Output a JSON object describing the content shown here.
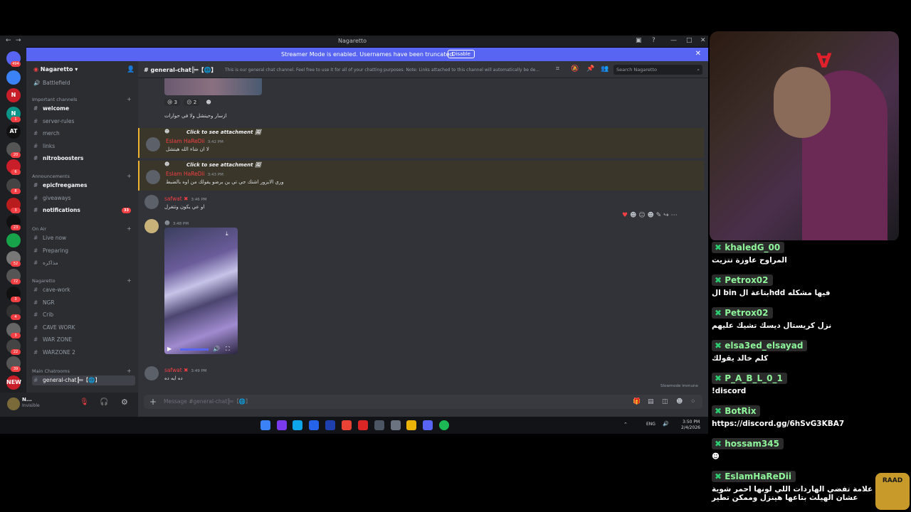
{
  "window": {
    "title": "Nagaretto"
  },
  "banner": {
    "message": "Streamer Mode is enabled. Usernames have been truncated.",
    "button": "Disable"
  },
  "rail": {
    "servers": [
      {
        "label": "",
        "badge": "494"
      },
      {
        "label": "",
        "badge": ""
      },
      {
        "label": "N",
        "badge": ""
      },
      {
        "label": "N",
        "badge": "1"
      },
      {
        "label": "AT",
        "badge": ""
      },
      {
        "label": "",
        "badge": "20"
      },
      {
        "label": "",
        "badge": "6"
      },
      {
        "label": "",
        "badge": "8"
      },
      {
        "label": "",
        "badge": "3"
      },
      {
        "label": "",
        "badge": "23"
      },
      {
        "label": "",
        "badge": ""
      },
      {
        "label": "",
        "badge": "52"
      },
      {
        "label": "",
        "badge": "72"
      },
      {
        "label": "",
        "badge": "3"
      },
      {
        "label": "",
        "badge": "4"
      },
      {
        "label": "",
        "badge": "3"
      },
      {
        "label": "",
        "badge": "22"
      },
      {
        "label": "",
        "badge": "39"
      },
      {
        "label": "NEW",
        "badge": ""
      }
    ]
  },
  "sidebar": {
    "server_name": "Nagaretto",
    "top_channel": "Battlefield",
    "categories": [
      {
        "name": "Important channels",
        "channels": [
          {
            "name": "welcome",
            "unread": true,
            "count": ""
          },
          {
            "name": "server-rules",
            "unread": false,
            "count": ""
          },
          {
            "name": "merch",
            "unread": false,
            "count": ""
          },
          {
            "name": "links",
            "unread": false,
            "count": ""
          },
          {
            "name": "nitroboosters",
            "unread": true,
            "count": ""
          }
        ]
      },
      {
        "name": "Announcements",
        "channels": [
          {
            "name": "epicfreegames",
            "unread": true,
            "count": ""
          },
          {
            "name": "giveaways",
            "unread": false,
            "count": ""
          },
          {
            "name": "notifications",
            "unread": true,
            "count": "33"
          }
        ]
      },
      {
        "name": "On Air",
        "channels": [
          {
            "name": "Live now",
            "unread": false,
            "count": ""
          },
          {
            "name": "Preparing",
            "unread": false,
            "count": ""
          },
          {
            "name": "مذاكره",
            "unread": false,
            "count": ""
          }
        ]
      },
      {
        "name": "Nagaretto",
        "channels": [
          {
            "name": "cave-work",
            "unread": false,
            "count": ""
          },
          {
            "name": "NGR",
            "unread": false,
            "count": ""
          },
          {
            "name": "Crib",
            "unread": false,
            "count": ""
          },
          {
            "name": "CAVE WORK",
            "unread": false,
            "count": ""
          },
          {
            "name": "WAR ZONE",
            "unread": false,
            "count": ""
          },
          {
            "name": "WARZONE 2",
            "unread": false,
            "count": ""
          }
        ]
      },
      {
        "name": "Main Chatrooms",
        "channels": [
          {
            "name": "general-chat╠═【🌐】",
            "unread": false,
            "count": ""
          }
        ]
      }
    ]
  },
  "user": {
    "name": "N...",
    "status": "Invisible"
  },
  "header": {
    "channel": "general-chat╠═【🌐】",
    "topic": "This is our general chat channel. Feel free to use it for all of your chatting purposes. Note: Links attached to this channel will automatically be de...",
    "search_placeholder": "Search Nagaretto"
  },
  "messages": [
    {
      "type": "continuation",
      "text": "ازسار وحيتشل ولا في حوارات",
      "reactions": [
        "😢 3",
        "😕 2",
        "☻"
      ]
    },
    {
      "type": "reply",
      "attachment": "Click to see attachment",
      "author": "Eslam HaReDii",
      "time": "3:42 PM",
      "text": "لا ان شاء الله هيتشل"
    },
    {
      "type": "reply",
      "attachment": "Click to see attachment",
      "author": "Eslam HaReDii",
      "time": "3:43 PM",
      "text": "وري الايزور اشتك جي تي ين برضو يقولك من اوه بالضبط"
    },
    {
      "type": "message",
      "author": "safwat",
      "time": "3:46 PM",
      "text": "او عي يكون وتتغرل"
    },
    {
      "type": "video",
      "author": "",
      "time": "3:48 PM"
    },
    {
      "type": "message",
      "author": "safwat",
      "time": "3:49 PM",
      "text": "ده ايه ده"
    }
  ],
  "slowmode": "Slowmode immune",
  "composer": {
    "placeholder": "Message #general-chat╠═【🌐】"
  },
  "taskbar": {
    "lang": "ENG",
    "time": "3:50 PM",
    "date": "2/4/2026"
  },
  "twitch_chat": [
    {
      "user": "khaledG_00",
      "text": "المراوح عاوزة تتزيت"
    },
    {
      "user": "Petrox02",
      "text": "فيها مشكله hddبتاعة ال bin ال"
    },
    {
      "user": "Petrox02",
      "text": "نزل كريستال ديسك تشيك عليهم"
    },
    {
      "user": "elsa3ed_elsayad",
      "text": "كلم خالد يقولك"
    },
    {
      "user": "P_A_B_L_0_1",
      "text": "!discord"
    },
    {
      "user": "BotRix",
      "text": "https://discord.gg/6hSvG3KBA7"
    },
    {
      "user": "hossam345",
      "text": "☻"
    },
    {
      "user": "EslamHaReDii",
      "text": "ت محتاج علامة تفضي الهاردات اللي لونها احمر شوية عشان الهيلث بتاعها هينزل وممكن تطير"
    }
  ],
  "colors": {
    "accent": "#5865f2",
    "mention": "#f0b232",
    "twitch_user": "#8ef59a",
    "danger": "#f23f43"
  }
}
